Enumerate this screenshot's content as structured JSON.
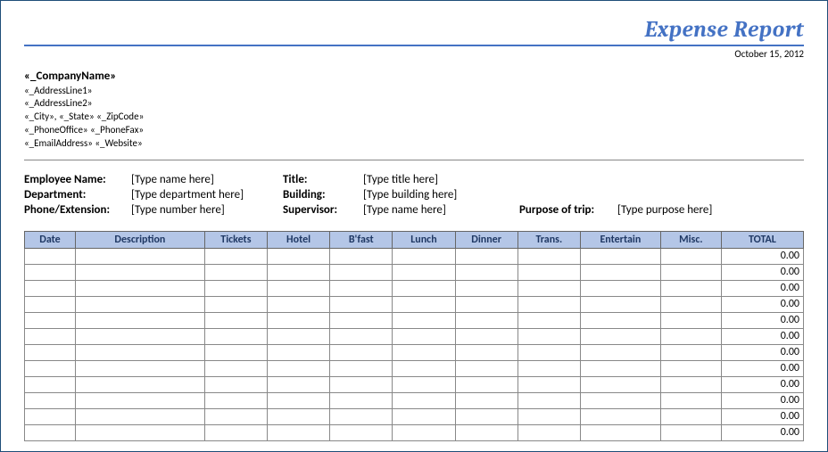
{
  "header": {
    "title": "Expense Report",
    "date": "October 15, 2012"
  },
  "company": {
    "name": "«_CompanyName»",
    "address1": "«_AddressLine1»",
    "address2": "«_AddressLine2»",
    "city_state_zip": "«_City», «_State» «_ZipCode»",
    "phones": "«_PhoneOffice» «_PhoneFax»",
    "email_web": "«_EmailAddress» «_Website»"
  },
  "info": {
    "employee_name_label": "Employee Name:",
    "employee_name_value": "[Type name here]",
    "title_label": "Title:",
    "title_value": "[Type title here]",
    "department_label": "Department:",
    "department_value": "[Type department here]",
    "building_label": "Building:",
    "building_value": "[Type building here]",
    "phone_ext_label": "Phone/Extension:",
    "phone_ext_value": "[Type number here]",
    "supervisor_label": "Supervisor:",
    "supervisor_value": "[Type name here]",
    "purpose_label": "Purpose of trip:",
    "purpose_value": "[Type purpose here]"
  },
  "table": {
    "headers": [
      "Date",
      "Description",
      "Tickets",
      "Hotel",
      "B'fast",
      "Lunch",
      "Dinner",
      "Trans.",
      "Entertain",
      "Misc.",
      "TOTAL"
    ],
    "rows": [
      {
        "total": "0.00"
      },
      {
        "total": "0.00"
      },
      {
        "total": "0.00"
      },
      {
        "total": "0.00"
      },
      {
        "total": "0.00"
      },
      {
        "total": "0.00"
      },
      {
        "total": "0.00"
      },
      {
        "total": "0.00"
      },
      {
        "total": "0.00"
      },
      {
        "total": "0.00"
      },
      {
        "total": "0.00"
      },
      {
        "total": "0.00"
      }
    ]
  }
}
